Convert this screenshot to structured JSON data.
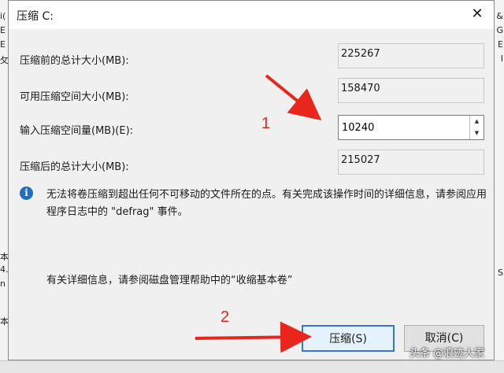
{
  "dialog": {
    "title": "压缩 C:",
    "close_glyph": "✕",
    "rows": [
      {
        "label": "压缩前的总计大小(MB):",
        "value": "225267"
      },
      {
        "label": "可用压缩空间大小(MB):",
        "value": "158470"
      },
      {
        "label": "输入压缩空间量(MB)(E):",
        "value": "10240"
      },
      {
        "label": "压缩后的总计大小(MB):",
        "value": "215027"
      }
    ],
    "info_text": "无法将卷压缩到超出任何不可移动的文件所在的点。有关完成该操作时间的详细信息，请参阅应用程序日志中的 \"defrag\" 事件。",
    "help_text": "有关详细信息，请参阅磁盘管理帮助中的“收缩基本卷”",
    "buttons": {
      "shrink": "压缩(S)",
      "cancel": "取消(C)"
    },
    "spin_up": "▲",
    "spin_down": "▼"
  },
  "annotations": {
    "step1": "1",
    "step2": "2",
    "color": "#e8261c"
  },
  "background": {
    "left_chars": [
      "i(",
      "E",
      "E",
      "攵",
      "本",
      "4.",
      "n",
      "本"
    ],
    "right_chars": [
      "&",
      "G",
      "E",
      "I",
      "S"
    ]
  },
  "watermark": "头条 @浪迹人家"
}
